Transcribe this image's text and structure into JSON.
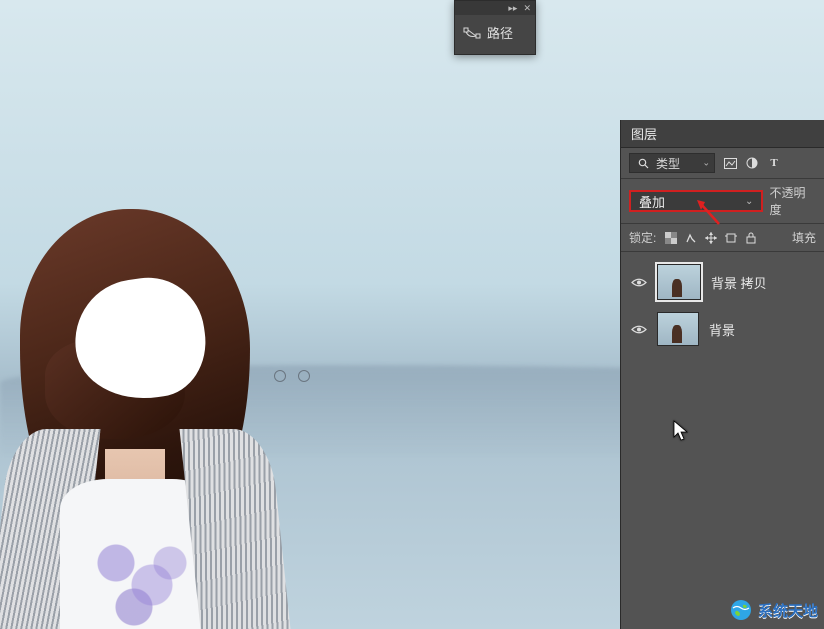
{
  "paths_panel": {
    "title": "路径"
  },
  "layers_panel": {
    "title": "图层",
    "filter_type_label": "类型",
    "blend_mode": "叠加",
    "opacity_label": "不透明度",
    "lock_label": "锁定:",
    "fill_label": "填充",
    "layers": [
      {
        "name": "背景 拷贝",
        "visible": true,
        "selected": true
      },
      {
        "name": "背景",
        "visible": true,
        "selected": false
      }
    ]
  },
  "watermark": {
    "text": "系统天地"
  }
}
